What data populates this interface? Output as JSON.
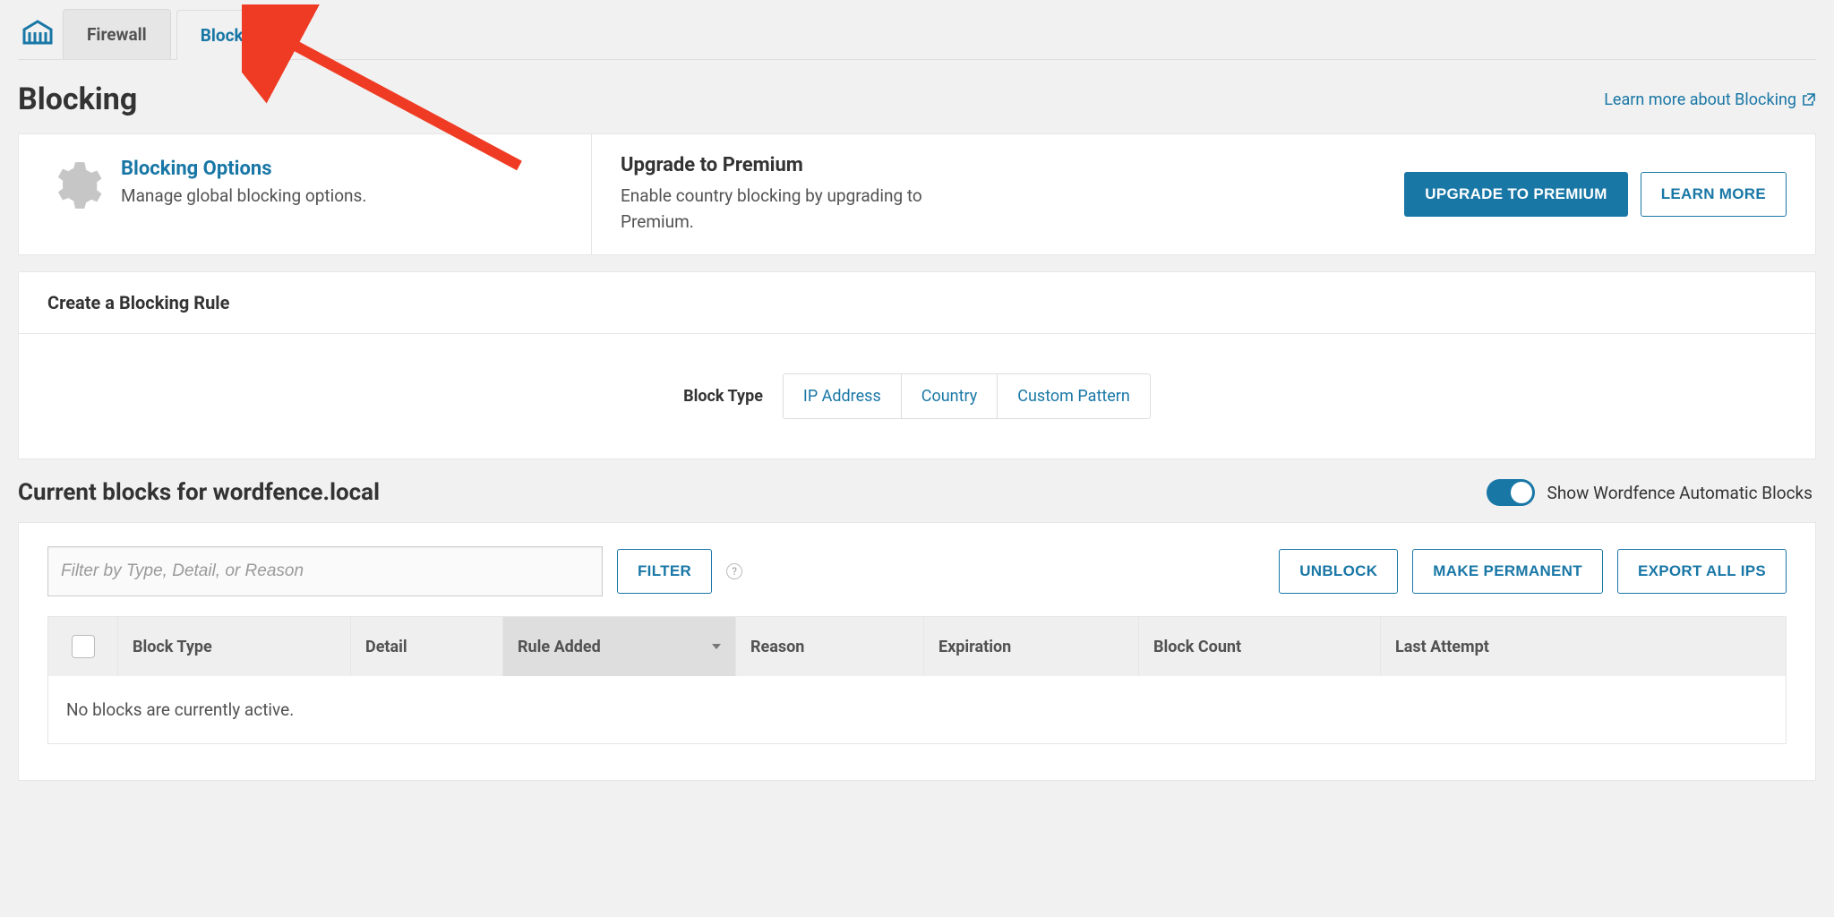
{
  "tabs": {
    "firewall": "Firewall",
    "blocking": "Blocking"
  },
  "page_title": "Blocking",
  "learn_more_link": "Learn more about Blocking",
  "options": {
    "title": "Blocking Options",
    "subtitle": "Manage global blocking options."
  },
  "premium": {
    "title": "Upgrade to Premium",
    "text": "Enable country blocking by upgrading to Premium.",
    "upgrade_btn": "UPGRADE TO PREMIUM",
    "learn_btn": "LEARN MORE"
  },
  "create_rule_title": "Create a Blocking Rule",
  "block_type_label": "Block Type",
  "block_types": {
    "ip": "IP Address",
    "country": "Country",
    "custom": "Custom Pattern"
  },
  "current_blocks_title": "Current blocks for wordfence.local",
  "auto_blocks_label": "Show Wordfence Automatic Blocks",
  "filter": {
    "placeholder": "Filter by Type, Detail, or Reason",
    "button": "FILTER"
  },
  "actions": {
    "unblock": "UNBLOCK",
    "permanent": "MAKE PERMANENT",
    "export": "EXPORT ALL IPS"
  },
  "table": {
    "headers": {
      "type": "Block Type",
      "detail": "Detail",
      "rule": "Rule Added",
      "reason": "Reason",
      "exp": "Expiration",
      "count": "Block Count",
      "last": "Last Attempt"
    },
    "empty": "No blocks are currently active."
  }
}
